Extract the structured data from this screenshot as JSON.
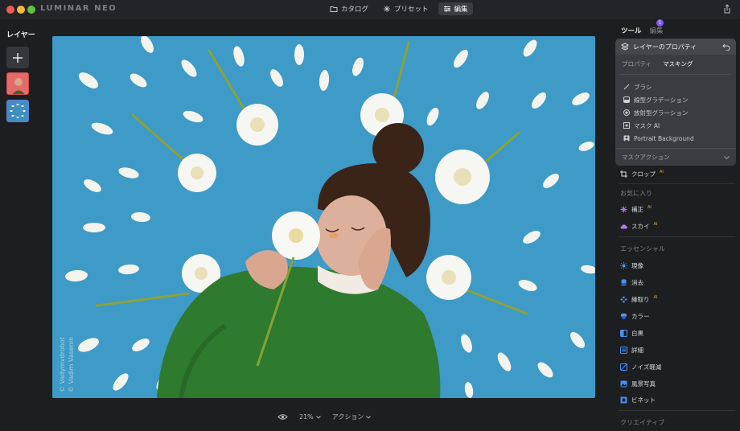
{
  "app": {
    "logo": "LUMINAR NEO"
  },
  "top_nav": [
    {
      "label": "カタログ",
      "icon": "folder-icon"
    },
    {
      "label": "プリセット",
      "icon": "sparkle-icon"
    },
    {
      "label": "編集",
      "icon": "sliders-icon",
      "active": true
    }
  ],
  "layers": {
    "title": "レイヤー"
  },
  "photo": {
    "watermark": [
      "© Vadymvdrobot",
      "© Vadim Vasenin"
    ]
  },
  "bottom_bar": {
    "zoom": "21%",
    "action": "アクション"
  },
  "right_panel": {
    "tabs": [
      {
        "label": "ツール",
        "active": true
      },
      {
        "label": "編集",
        "active": false
      }
    ],
    "badge": "1",
    "props": {
      "title": "レイヤーのプロパティ",
      "subtabs": [
        {
          "label": "プロパティ",
          "selected": false
        },
        {
          "label": "マスキング",
          "selected": true
        }
      ],
      "items": [
        {
          "label": "ブラシ",
          "icon": "brush-icon"
        },
        {
          "label": "線型グラデーション",
          "icon": "linear-gradient-icon"
        },
        {
          "label": "放射型グラーション",
          "icon": "radial-gradient-icon"
        },
        {
          "label": "マスク AI",
          "icon": "mask-ai-icon"
        },
        {
          "label": "Portrait Background",
          "icon": "portrait-icon"
        }
      ],
      "mask_action": "マスクアクション"
    },
    "crop": {
      "label": "クロップ",
      "ai": "AI"
    },
    "favorites": {
      "title": "お気に入り",
      "items": [
        {
          "label": "補正",
          "ai": "AI",
          "icon": "enhance-icon",
          "color": "#b47cf0"
        },
        {
          "label": "スカイ",
          "ai": "AI",
          "icon": "cloud-icon",
          "color": "#b47cf0"
        }
      ]
    },
    "essentials": {
      "title": "エッセンシャル",
      "items": [
        {
          "label": "現像",
          "ai": "",
          "icon": "develop-icon",
          "color": "#4c8ff5"
        },
        {
          "label": "消去",
          "ai": "",
          "icon": "eraser-icon",
          "color": "#4c8ff5"
        },
        {
          "label": "縁取り",
          "ai": "AI",
          "icon": "structure-icon",
          "color": "#4c8ff5"
        },
        {
          "label": "カラー",
          "ai": "",
          "icon": "color-icon",
          "color": "#4c8ff5"
        },
        {
          "label": "白黒",
          "ai": "",
          "icon": "bw-icon",
          "color": "#4c8ff5"
        },
        {
          "label": "詳細",
          "ai": "",
          "icon": "details-icon",
          "color": "#4c8ff5"
        },
        {
          "label": "ノイズ軽減",
          "ai": "",
          "icon": "denoise-icon",
          "color": "#4c8ff5"
        },
        {
          "label": "風景写真",
          "ai": "",
          "icon": "landscape-icon",
          "color": "#4c8ff5"
        },
        {
          "label": "ビネット",
          "ai": "",
          "icon": "vignette-icon",
          "color": "#4c8ff5"
        }
      ]
    },
    "creative": {
      "title": "クリエイティブ"
    }
  }
}
